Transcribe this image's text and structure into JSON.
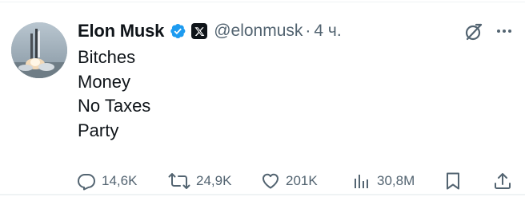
{
  "author": {
    "name": "Elon Musk",
    "handle": "@elonmusk",
    "separator": "·",
    "time": "4 ч."
  },
  "tweet": {
    "lines": [
      "Bitches",
      "Money",
      "No Taxes",
      "Party"
    ]
  },
  "actions": {
    "replies": "14,6K",
    "reposts": "24,9K",
    "likes": "201K",
    "views": "30,8M"
  },
  "icons": {
    "verified": "verified-badge-icon",
    "affiliate": "x-logo-icon",
    "grok": "grok-icon",
    "more": "more-icon",
    "reply": "reply-icon",
    "repost": "repost-icon",
    "like": "heart-icon",
    "views": "views-icon",
    "bookmark": "bookmark-icon",
    "share": "share-icon"
  },
  "colors": {
    "text": "#0f1419",
    "secondary": "#536471",
    "verified": "#1d9bf0",
    "divider": "#eff3f4"
  }
}
